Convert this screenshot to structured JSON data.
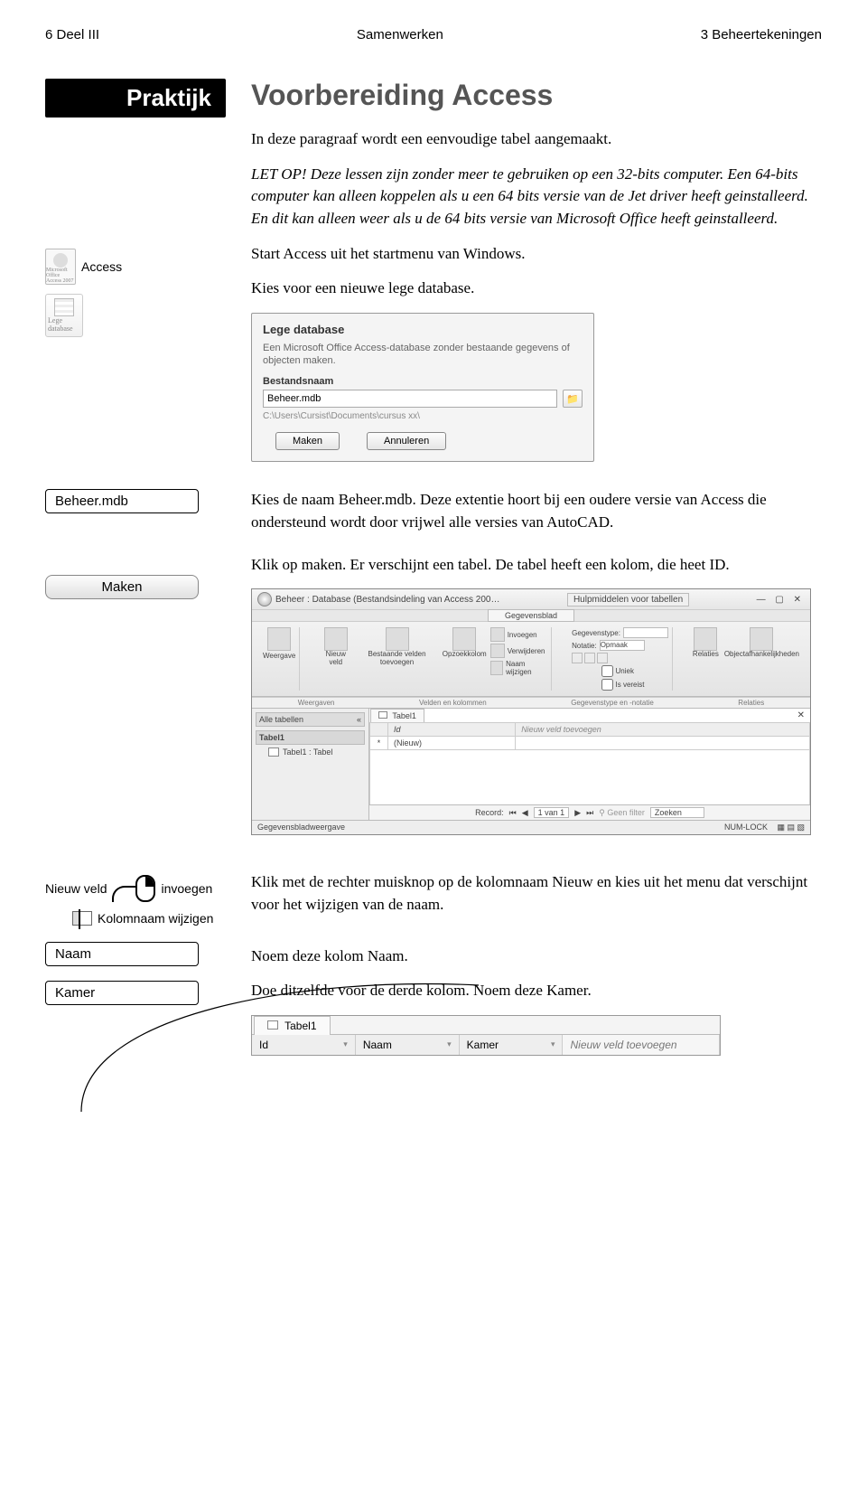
{
  "header": {
    "left": "6 Deel III",
    "center": "Samenwerken",
    "right": "3 Beheertekeningen"
  },
  "praktijk_label": "Praktijk",
  "title": "Voorbereiding Access",
  "paragraphs": {
    "intro": "In deze paragraaf wordt een eenvoudige tabel aangemaakt.",
    "letop": "LET OP! Deze lessen zijn zonder meer te gebruiken op een 32-bits computer. Een 64-bits computer kan alleen koppelen als u een 64 bits versie van de Jet driver heeft geinstalleerd. En dit kan alleen weer als u de 64 bits versie van Microsoft Office heeft geinstalleerd.",
    "start_access": "Start Access uit het startmenu van Windows.",
    "kies_lege": "Kies voor een nieuwe lege database.",
    "beheer_mdb": "Kies de naam Beheer.mdb. Deze extentie hoort bij een oudere versie van Access die ondersteund wordt door vrijwel alle versies van AutoCAD.",
    "maken": "Klik op maken. Er verschijnt een tabel. De tabel heeft een kolom, die heet ID.",
    "rechter_muis": "Klik met de rechter muisknop op de kolomnaam Nieuw en kies uit het menu dat verschijnt voor het wijzigen van de naam.",
    "noem_naam": "Noem deze kolom Naam.",
    "noem_kamer": "Doe ditzelfde voor de derde kolom. Noem deze Kamer."
  },
  "left_icons": {
    "access_caption": "Microsoft Office Access 2007",
    "access_label": "Access",
    "lege_db_caption": "Lege database"
  },
  "lege_db_panel": {
    "title": "Lege database",
    "subtitle": "Een Microsoft Office Access-database zonder bestaande gegevens of objecten maken.",
    "field_label": "Bestandsnaam",
    "filename": "Beheer.mdb",
    "path": "C:\\Users\\Cursist\\Documents\\cursus xx\\",
    "btn_maken": "Maken",
    "btn_annuleren": "Annuleren"
  },
  "left_inputs": {
    "beheer_mdb": "Beheer.mdb",
    "maken_btn": "Maken",
    "naam": "Naam",
    "kamer": "Kamer",
    "nieuw_veld_invoegen": "invoegen",
    "nieuw_veld_left": "Nieuw veld",
    "kolomnaam_wijzigen": "Kolomnaam wijzigen"
  },
  "ribbon": {
    "title": "Beheer : Database (Bestandsindeling van Access 200…",
    "context_tab_group": "Hulpmiddelen voor tabellen",
    "context_tab": "Gegevensblad",
    "groups": {
      "weergave": "Weergave",
      "nieuw_veld": "Nieuw veld",
      "bestaande": "Bestaande velden toevoegen",
      "opzoek": "Opzoekkolom",
      "invoegen": "Invoegen",
      "verwijderen": "Verwijderen",
      "naam_wijzigen": "Naam wijzigen",
      "gegevenstype": "Gegevenstype:",
      "notatie": "Notatie:",
      "opmaak": "Opmaak",
      "uniek": "Uniek",
      "vereist": "Is vereist",
      "relaties": "Relaties",
      "afhankelijk": "Objectafhankelijkheden"
    },
    "section_labels": {
      "weergaven": "Weergaven",
      "velden_kolommen": "Velden en kolommen",
      "gegevenstype_notatie": "Gegevenstype en -notatie",
      "relaties": "Relaties"
    },
    "nav": {
      "all_tables": "Alle tabellen",
      "tabel1": "Tabel1",
      "tabel1_tabel": "Tabel1 : Tabel"
    },
    "datasheet": {
      "tab": "Tabel1",
      "col_id": "Id",
      "col_new": "Nieuw veld toevoegen",
      "row_new": "(Nieuw)"
    },
    "recordbar": {
      "label": "Record:",
      "pos": "1 van 1",
      "geen_filter": "Geen filter",
      "zoeken": "Zoeken"
    },
    "statusbar": {
      "left": "Gegevensbladweergave",
      "right": "NUM-LOCK"
    }
  },
  "tabel1_strip": {
    "tab": "Tabel1",
    "cols": [
      "Id",
      "Naam",
      "Kamer",
      "Nieuw veld toevoegen"
    ]
  }
}
